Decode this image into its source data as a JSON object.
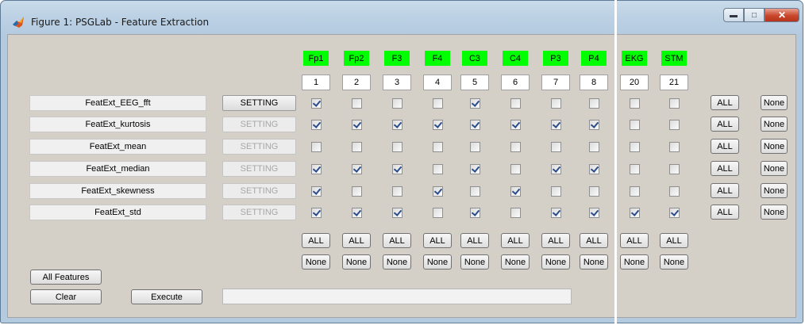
{
  "window": {
    "title": "Figure 1: PSGLab - Feature Extraction"
  },
  "channels": [
    {
      "label": "Fp1",
      "num": "1"
    },
    {
      "label": "Fp2",
      "num": "2"
    },
    {
      "label": "F3",
      "num": "3"
    },
    {
      "label": "F4",
      "num": "4"
    },
    {
      "label": "C3",
      "num": "5"
    },
    {
      "label": "C4",
      "num": "6"
    },
    {
      "label": "P3",
      "num": "7"
    },
    {
      "label": "P4",
      "num": "8"
    },
    {
      "label": "EKG",
      "num": "20"
    },
    {
      "label": "STM",
      "num": "21"
    }
  ],
  "features": [
    {
      "name": "FeatExt_EEG_fft",
      "setting_label": "SETTING",
      "setting_enabled": true,
      "checks": [
        true,
        false,
        false,
        false,
        true,
        false,
        false,
        false,
        false,
        false
      ]
    },
    {
      "name": "FeatExt_kurtosis",
      "setting_label": "SETTING",
      "setting_enabled": false,
      "checks": [
        true,
        true,
        true,
        true,
        true,
        true,
        true,
        true,
        false,
        false
      ]
    },
    {
      "name": "FeatExt_mean",
      "setting_label": "SETTING",
      "setting_enabled": false,
      "checks": [
        false,
        false,
        false,
        false,
        false,
        false,
        false,
        false,
        false,
        false
      ]
    },
    {
      "name": "FeatExt_median",
      "setting_label": "SETTING",
      "setting_enabled": false,
      "checks": [
        true,
        true,
        true,
        false,
        true,
        false,
        true,
        true,
        false,
        false
      ]
    },
    {
      "name": "FeatExt_skewness",
      "setting_label": "SETTING",
      "setting_enabled": false,
      "checks": [
        true,
        false,
        false,
        true,
        false,
        true,
        false,
        false,
        false,
        false
      ]
    },
    {
      "name": "FeatExt_std",
      "setting_label": "SETTING",
      "setting_enabled": false,
      "checks": [
        true,
        true,
        true,
        false,
        true,
        false,
        true,
        true,
        true,
        true
      ]
    }
  ],
  "buttons": {
    "all_label": "ALL",
    "none_label": "None",
    "all_features": "All Features",
    "clear": "Clear",
    "execute": "Execute"
  },
  "colors": {
    "channel_bg": "#00ff00"
  }
}
